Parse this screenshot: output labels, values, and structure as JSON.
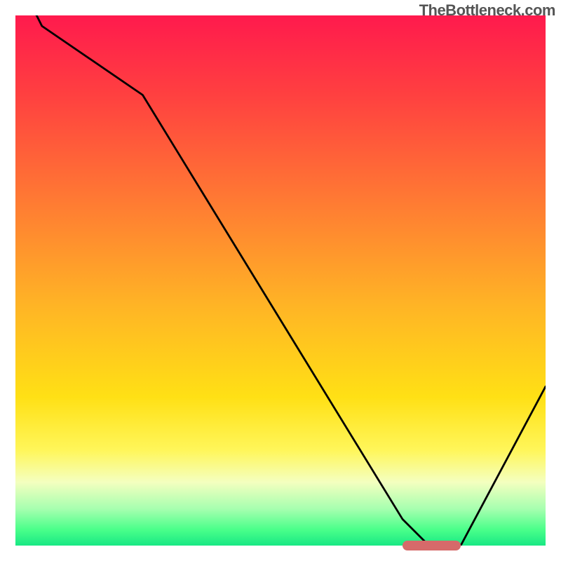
{
  "watermark": "TheBottleneck.com",
  "chart_data": {
    "type": "line",
    "title": "",
    "xlabel": "",
    "ylabel": "",
    "x": [
      0,
      4,
      5,
      24,
      73,
      78,
      84,
      100
    ],
    "values": [
      105,
      100,
      98,
      85,
      5,
      0,
      0,
      30
    ],
    "xlim": [
      0,
      100
    ],
    "ylim": [
      0,
      100
    ],
    "gradient_background": {
      "top_color": "#ff1a4d",
      "bottom_color": "#18e884",
      "orientation": "vertical"
    },
    "marker_segment": {
      "x_start": 73,
      "x_end": 84,
      "y": 0,
      "color": "#d66a6a"
    },
    "line_color": "#000000"
  }
}
